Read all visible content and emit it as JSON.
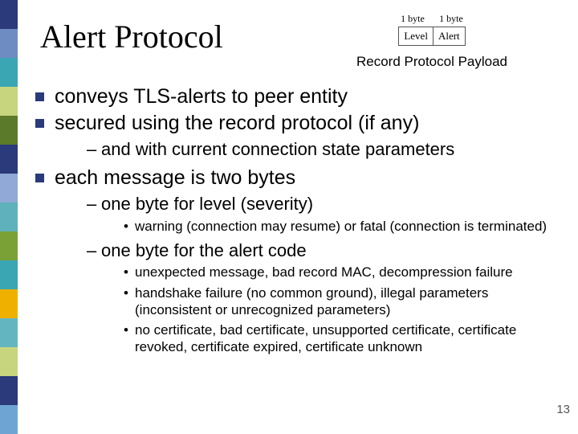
{
  "title": "Alert Protocol",
  "diagram": {
    "byte_label_1": "1 byte",
    "byte_label_2": "1 byte",
    "cell_1": "Level",
    "cell_2": "Alert",
    "caption": "Record Protocol Payload"
  },
  "bullets": {
    "b1": "conveys TLS-alerts to peer entity",
    "b2": "secured using the record protocol (if any)",
    "b2_sub1": "and with current connection state parameters",
    "b3": "each message is two bytes",
    "b3_sub1": "one byte for level (severity)",
    "b3_sub1_dot1": "warning (connection may resume) or fatal (connection is terminated)",
    "b3_sub2": "one byte for the alert code",
    "b3_sub2_dot1": "unexpected message, bad record MAC, decompression failure",
    "b3_sub2_dot2": "handshake failure (no common ground), illegal parameters (inconsistent or unrecognized parameters)",
    "b3_sub2_dot3": "no certificate, bad certificate, unsupported certificate, certificate revoked, certificate expired, certificate unknown"
  },
  "page_number": "13"
}
